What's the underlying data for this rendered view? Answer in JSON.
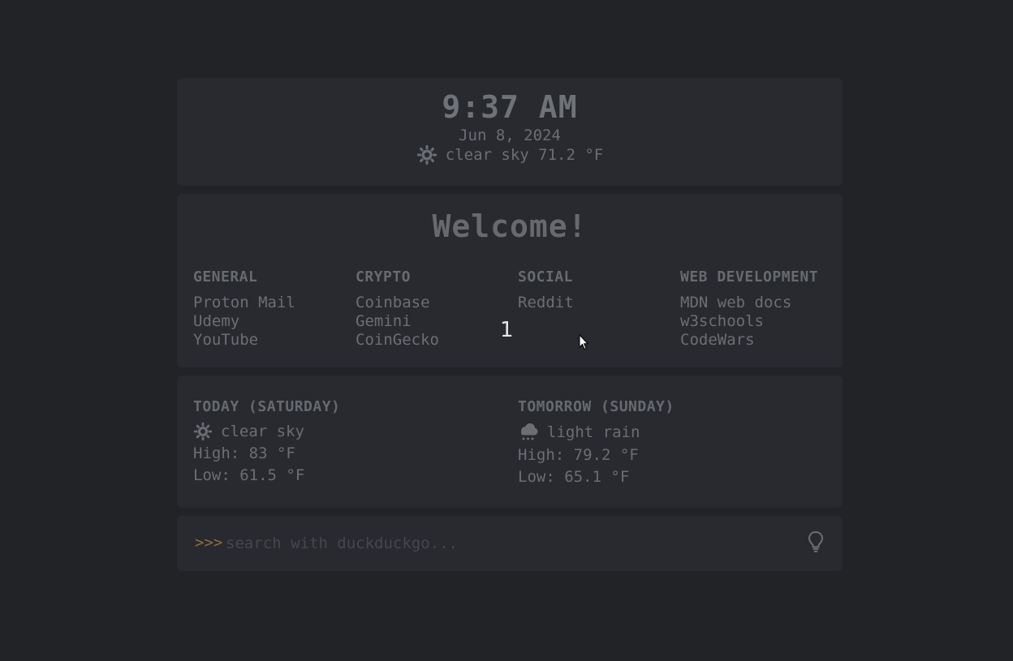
{
  "clock": {
    "time": "9:37 AM",
    "date": "Jun 8, 2024",
    "weather_icon": "sun-icon",
    "weather": "clear sky 71.2 °F"
  },
  "welcome": {
    "title": "Welcome!",
    "columns": [
      {
        "heading": "GENERAL",
        "links": [
          "Proton Mail",
          "Udemy",
          "YouTube"
        ]
      },
      {
        "heading": "CRYPTO",
        "links": [
          "Coinbase",
          "Gemini",
          "CoinGecko"
        ]
      },
      {
        "heading": "SOCIAL",
        "links": [
          "Reddit"
        ]
      },
      {
        "heading": "WEB DEVELOPMENT",
        "links": [
          "MDN web docs",
          "w3schools",
          "CodeWars"
        ]
      }
    ]
  },
  "overlay": {
    "number": "1"
  },
  "forecast": {
    "today": {
      "heading": "TODAY (SATURDAY)",
      "icon": "sun-icon",
      "condition": "clear sky",
      "high": "High: 83 °F",
      "low": "Low: 61.5 °F"
    },
    "tomorrow": {
      "heading": "TOMORROW (SUNDAY)",
      "icon": "rain-cloud-icon",
      "condition": "light rain",
      "high": "High: 79.2 °F",
      "low": "Low: 65.1 °F"
    }
  },
  "search": {
    "prompt": ">>>",
    "placeholder": "search with duckduckgo...",
    "value": "",
    "tip_icon": "lightbulb-icon"
  },
  "colors": {
    "background": "#212327",
    "card": "#282a30",
    "text": "#6b6e73",
    "prompt": "#8a6d3b"
  }
}
